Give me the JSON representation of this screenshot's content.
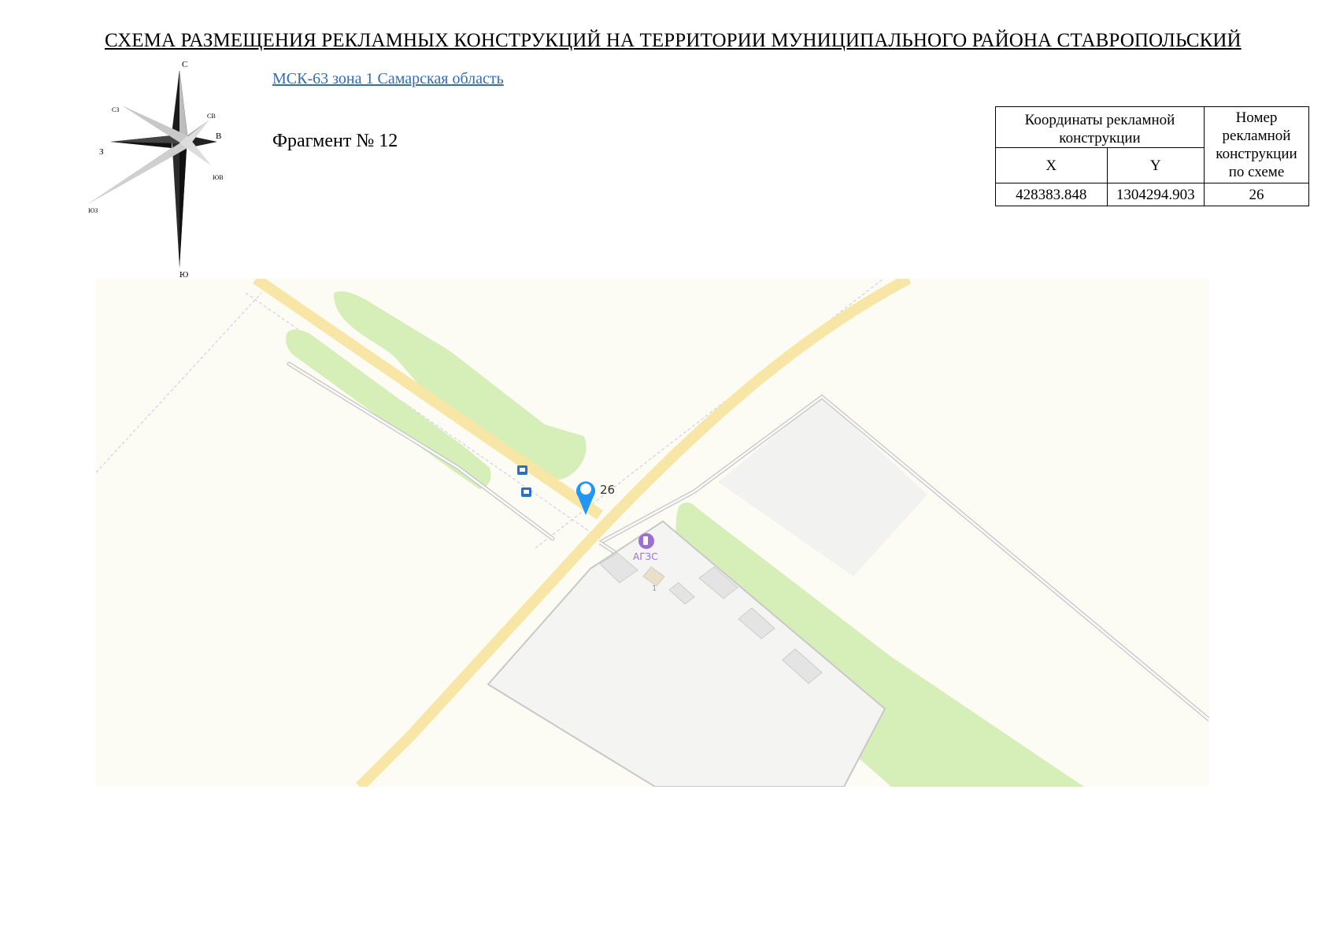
{
  "header": {
    "title": "СХЕМА РАЗМЕЩЕНИЯ РЕКЛАМНЫХ КОНСТРУКЦИЙ НА ТЕРРИТОРИИ МУНИЦИПАЛЬНОГО РАЙОНА СТАВРОПОЛЬСКИЙ",
    "crs_link": "МСК-63 зона 1 Самарская область",
    "fragment_label": "Фрагмент № 12"
  },
  "compass": {
    "n": "С",
    "ne": "СВ",
    "e": "В",
    "se": "ЮВ",
    "s": "Ю",
    "sw": "ЮЗ",
    "w": "З",
    "nw": "СЗ"
  },
  "coords_table": {
    "header_coords": "Координаты рекламной конструкции",
    "header_number": "Номер рекламной конструкции по схеме",
    "col_x": "X",
    "col_y": "Y",
    "rows": [
      {
        "x": "428383.848",
        "y": "1304294.903",
        "number": "26"
      }
    ]
  },
  "map": {
    "marker_label": "26",
    "gas_station_label": "АГЗС",
    "building_number": "1",
    "colors": {
      "background": "#fdfcf4",
      "road": "#f8e6a6",
      "green": "#d6efb9",
      "area": "#f2f2f0",
      "marker": "#2196f3",
      "poi": "#9c6fd6",
      "bus_stop": "#2a6fc9"
    },
    "icons": [
      "bus-stop-icon",
      "gas-station-icon",
      "location-pin-icon"
    ]
  }
}
